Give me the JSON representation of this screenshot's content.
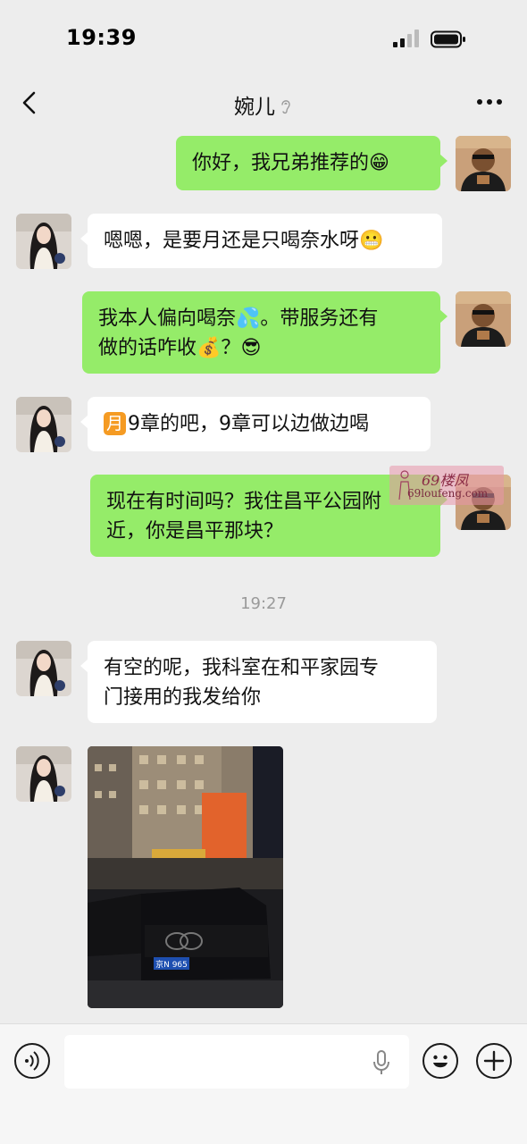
{
  "status_bar": {
    "time": "19:39"
  },
  "header": {
    "contact_name": "婉儿"
  },
  "messages": [
    {
      "sender": "me",
      "text": "你好，我兄弟推荐的",
      "emoji": "😁"
    },
    {
      "sender": "contact",
      "text": "嗯嗯，是要月还是只喝奈水呀",
      "emoji": "😬"
    },
    {
      "sender": "me",
      "line1_a": "我本人偏向喝奈",
      "emoji1": "💦",
      "line1_b": "。带服务还有",
      "line2": "做的话咋收",
      "emoji2": "💰",
      "line2_b": "？",
      "emoji3": "😎"
    },
    {
      "sender": "contact",
      "badge": "月",
      "text": "9章的吧，9章可以边做边喝"
    },
    {
      "sender": "me",
      "line1": "现在有时间吗？我住昌平公园附",
      "line2": "近，你是昌平那块？"
    },
    {
      "sender": "contact",
      "line1": "有空的呢，我科室在和平家园专",
      "line2": "门接用的我发给你"
    },
    {
      "sender": "contact",
      "type": "image",
      "plate_text": "京N 965"
    }
  ],
  "timestamp_divider": "19:27",
  "watermark": {
    "text": "69楼凤",
    "url": "69loufeng.com"
  },
  "colors": {
    "background": "#ededed",
    "my_bubble": "#95ec69",
    "their_bubble": "#ffffff"
  },
  "icons": [
    "back-arrow-icon",
    "ear-icon",
    "more-icon",
    "voice-icon",
    "microphone-icon",
    "emoji-icon",
    "plus-icon"
  ]
}
